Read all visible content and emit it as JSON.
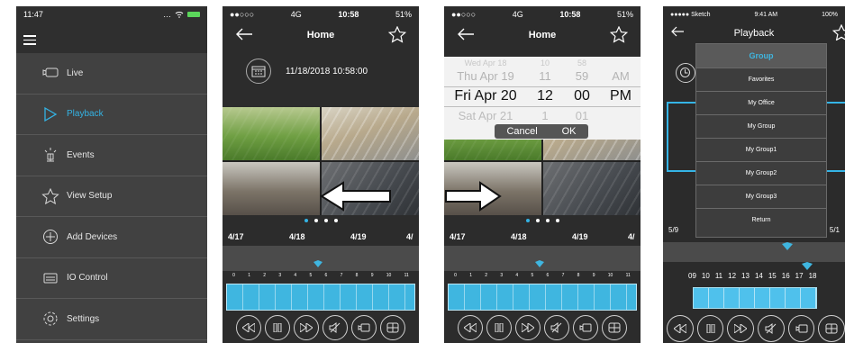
{
  "phone1": {
    "status": {
      "time": "11:47",
      "signal": "…"
    },
    "menu": [
      {
        "label": "Live",
        "icon": "live-camera-icon"
      },
      {
        "label": "Playback",
        "icon": "playback-icon",
        "active": true
      },
      {
        "label": "Events",
        "icon": "events-icon"
      },
      {
        "label": "View Setup",
        "icon": "star-outline-icon"
      },
      {
        "label": "Add Devices",
        "icon": "add-device-icon"
      },
      {
        "label": "IO Control",
        "icon": "io-control-icon"
      },
      {
        "label": "Settings",
        "icon": "settings-gear-icon"
      }
    ]
  },
  "phone2": {
    "status": {
      "carrier": "●●○○○",
      "network": "4G",
      "time": "10:58",
      "battery": "51%"
    },
    "title": "Home",
    "datetime": "11/18/2018 10:58:00",
    "dates": [
      "4/17",
      "4/18",
      "4/19",
      "4/"
    ],
    "hours": [
      "0",
      "1",
      "2",
      "3",
      "4",
      "5",
      "6",
      "7",
      "8",
      "9",
      "10",
      "11"
    ]
  },
  "phone3": {
    "status": {
      "carrier": "●●○○○",
      "network": "4G",
      "time": "10:58",
      "battery": "51%"
    },
    "title": "Home",
    "picker": {
      "top": {
        "date": "Wed Apr 18",
        "hour": "10",
        "minute": "58",
        "period": ""
      },
      "above": {
        "date": "Thu Apr 19",
        "hour": "11",
        "minute": "59",
        "period": "AM"
      },
      "selected": {
        "date": "Fri Apr 20",
        "hour": "12",
        "minute": "00",
        "period": "PM"
      },
      "below": {
        "date": "Sat Apr 21",
        "hour": "1",
        "minute": "01",
        "period": ""
      }
    },
    "cancel_label": "Cancel",
    "ok_label": "OK",
    "dates": [
      "4/17",
      "4/18",
      "4/19",
      "4/"
    ],
    "hours": [
      "0",
      "1",
      "2",
      "3",
      "4",
      "5",
      "6",
      "7",
      "8",
      "9",
      "10",
      "11"
    ]
  },
  "phone4": {
    "status": {
      "carrier": "●●●●● Sketch",
      "time": "9:41 AM",
      "battery": "100%"
    },
    "title": "Playback",
    "dropdown": {
      "header": "Group",
      "items": [
        "Favorites",
        "My Office",
        "My Group",
        "My Group1",
        "My Group2",
        "My Group3",
        "Return"
      ]
    },
    "dates": [
      "5/9",
      "5/1"
    ],
    "hours": [
      "09",
      "10",
      "11",
      "12",
      "13",
      "14",
      "15",
      "16",
      "17",
      "18"
    ]
  },
  "colors": {
    "accent": "#34b3e4",
    "panel": "#2b2b2b",
    "menu": "#414141"
  }
}
